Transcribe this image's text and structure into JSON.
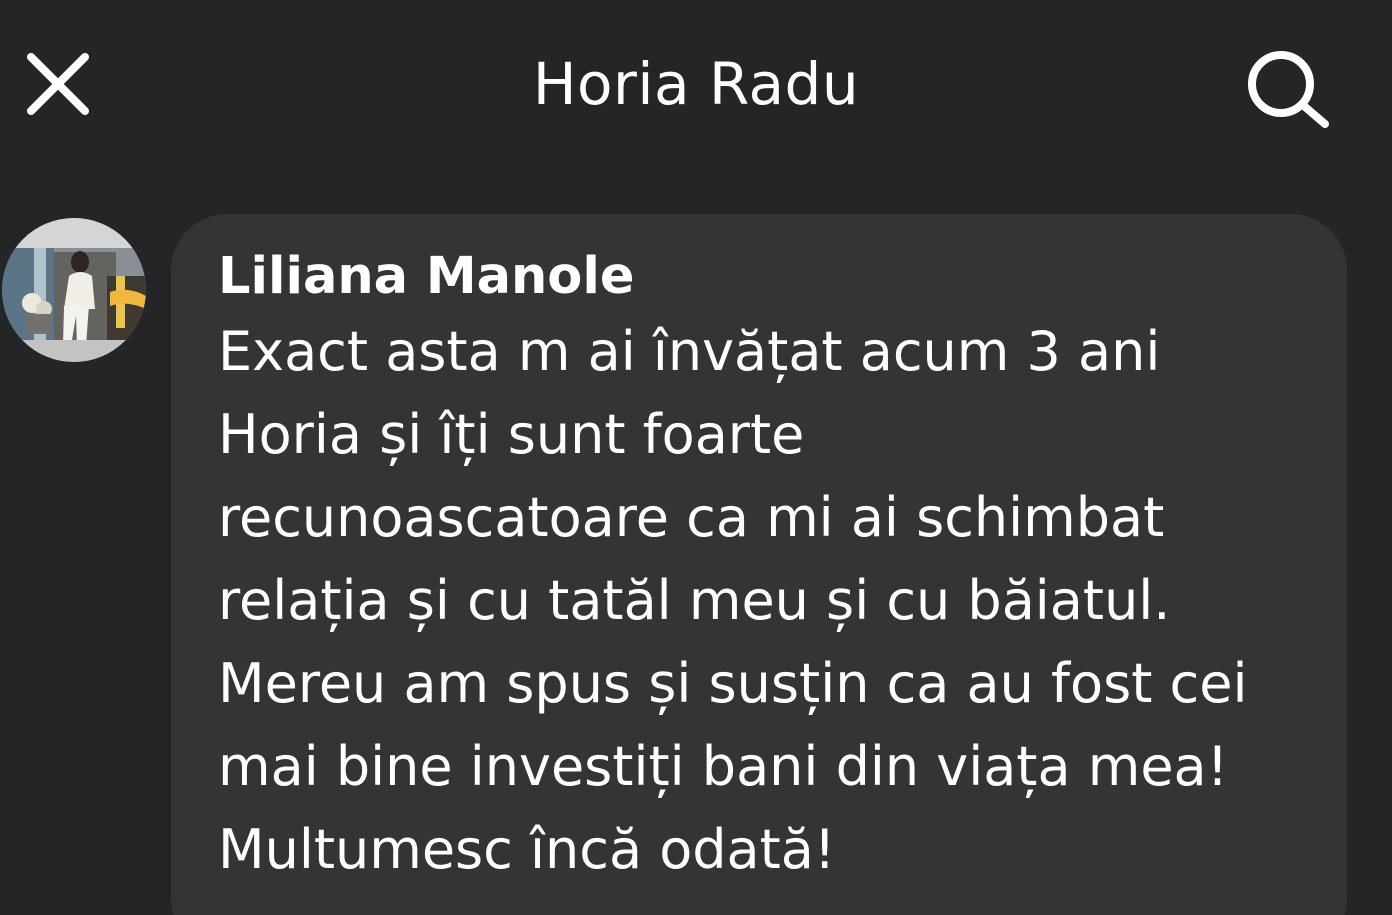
{
  "header": {
    "title": "Horia Radu",
    "close_icon": "close-icon",
    "search_icon": "search-icon"
  },
  "comment": {
    "author": "Liliana Manole",
    "avatar_icon": "avatar",
    "text": "Exact asta m ai învățat acum 3 ani\nHoria și îți sunt foarte\nrecunoascatoare ca mi ai schimbat\nrelația și cu tatăl meu și cu băiatul.\nMereu am spus și susțin ca au fost cei\nmai bine investiți bani din viața mea!\nMultumesc încă odată!"
  },
  "colors": {
    "background": "#242527",
    "bubble": "#333436",
    "text": "#ffffff"
  }
}
